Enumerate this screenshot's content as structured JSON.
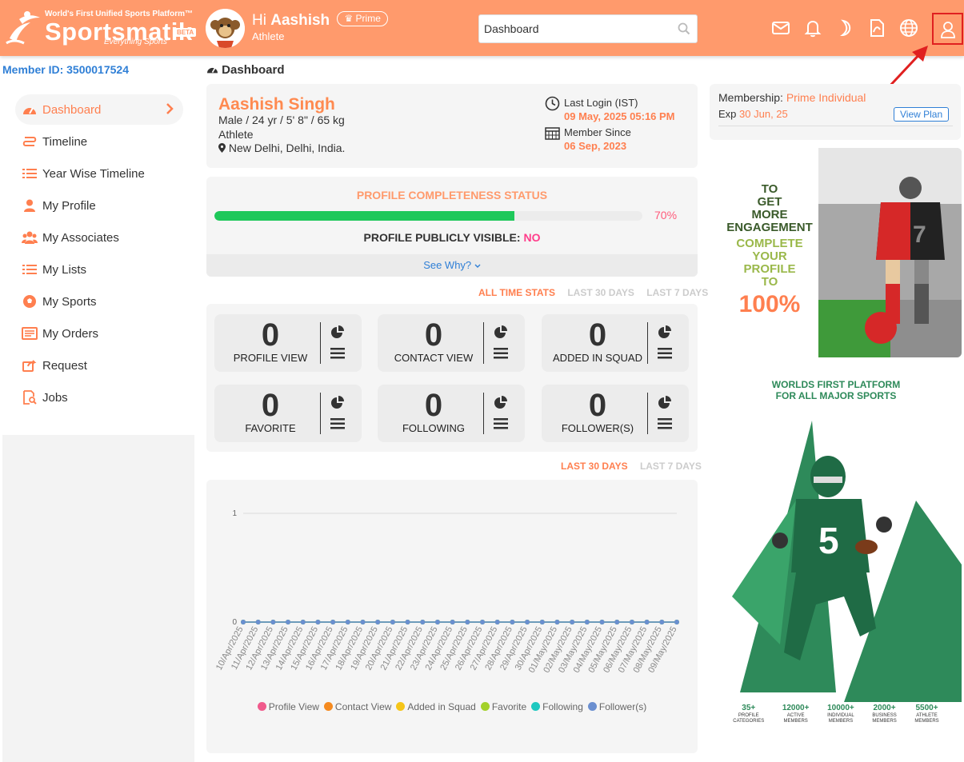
{
  "header": {
    "tagline": "World's First Unified Sports Platform™",
    "brand": "Sportsmatik",
    "beta": "BETA",
    "subtag": "Everything Sports",
    "greeting_prefix": "Hi",
    "user_first_name": "Aashish",
    "prime_badge": "Prime",
    "role": "Athlete",
    "search_value": "Dashboard",
    "bg_color": "#ff9a6c"
  },
  "member_id": "Member ID: 3500017524",
  "breadcrumb": "Dashboard",
  "sidebar": {
    "items": [
      {
        "label": "Dashboard",
        "icon": "dashboard-gauge-icon",
        "active": true
      },
      {
        "label": "Timeline",
        "icon": "timeline-route-icon"
      },
      {
        "label": "Year Wise Timeline",
        "icon": "list-icon"
      },
      {
        "label": "My Profile",
        "icon": "user-icon"
      },
      {
        "label": "My Associates",
        "icon": "users-icon"
      },
      {
        "label": "My Lists",
        "icon": "list-icon"
      },
      {
        "label": "My Sports",
        "icon": "soccer-ball-icon"
      },
      {
        "label": "My Orders",
        "icon": "orders-icon"
      },
      {
        "label": "Request",
        "icon": "share-request-icon"
      },
      {
        "label": "Jobs",
        "icon": "jobs-search-icon"
      }
    ]
  },
  "profile": {
    "name": "Aashish Singh",
    "details": "Male / 24 yr / 5' 8\" / 65 kg",
    "role": "Athlete",
    "location": "New Delhi, Delhi, India.",
    "last_login_label": "Last Login (IST)",
    "last_login_value": "09 May, 2025 05:16 PM",
    "member_since_label": "Member Since",
    "member_since_value": "06 Sep, 2023"
  },
  "completeness": {
    "title": "PROFILE COMPLETENESS STATUS",
    "percent": 70,
    "percent_label": "70%",
    "visible_label": "PROFILE PUBLICLY VISIBLE:",
    "visible_value": "NO",
    "see_why": "See Why?"
  },
  "stat_tabs": [
    "ALL TIME STATS",
    "LAST 30 DAYS",
    "LAST 7 DAYS"
  ],
  "stats": [
    {
      "value": "0",
      "label": "PROFILE VIEW"
    },
    {
      "value": "0",
      "label": "CONTACT VIEW"
    },
    {
      "value": "0",
      "label": "ADDED IN SQUAD"
    },
    {
      "value": "0",
      "label": "FAVORITE"
    },
    {
      "value": "0",
      "label": "FOLLOWING"
    },
    {
      "value": "0",
      "label": "FOLLOWER(S)"
    }
  ],
  "chart_tabs": [
    "LAST 30 DAYS",
    "LAST 7 DAYS"
  ],
  "chart_data": {
    "type": "line",
    "x": [
      "10/Apr/2025",
      "11/Apr/2025",
      "12/Apr/2025",
      "13/Apr/2025",
      "14/Apr/2025",
      "15/Apr/2025",
      "16/Apr/2025",
      "17/Apr/2025",
      "18/Apr/2025",
      "19/Apr/2025",
      "20/Apr/2025",
      "21/Apr/2025",
      "22/Apr/2025",
      "23/Apr/2025",
      "24/Apr/2025",
      "25/Apr/2025",
      "26/Apr/2025",
      "27/Apr/2025",
      "28/Apr/2025",
      "29/Apr/2025",
      "30/Apr/2025",
      "01/May/2025",
      "02/May/2025",
      "03/May/2025",
      "04/May/2025",
      "05/May/2025",
      "06/May/2025",
      "07/May/2025",
      "08/May/2025",
      "09/May/2025"
    ],
    "yticks": [
      0,
      1
    ],
    "ylim": [
      0,
      1
    ],
    "series": [
      {
        "name": "Profile View",
        "color": "#f05a8c",
        "values": [
          0,
          0,
          0,
          0,
          0,
          0,
          0,
          0,
          0,
          0,
          0,
          0,
          0,
          0,
          0,
          0,
          0,
          0,
          0,
          0,
          0,
          0,
          0,
          0,
          0,
          0,
          0,
          0,
          0,
          0
        ]
      },
      {
        "name": "Contact View",
        "color": "#f58a1f",
        "values": [
          0,
          0,
          0,
          0,
          0,
          0,
          0,
          0,
          0,
          0,
          0,
          0,
          0,
          0,
          0,
          0,
          0,
          0,
          0,
          0,
          0,
          0,
          0,
          0,
          0,
          0,
          0,
          0,
          0,
          0
        ]
      },
      {
        "name": "Added in Squad",
        "color": "#f5c518",
        "values": [
          0,
          0,
          0,
          0,
          0,
          0,
          0,
          0,
          0,
          0,
          0,
          0,
          0,
          0,
          0,
          0,
          0,
          0,
          0,
          0,
          0,
          0,
          0,
          0,
          0,
          0,
          0,
          0,
          0,
          0
        ]
      },
      {
        "name": "Favorite",
        "color": "#a3d12a",
        "values": [
          0,
          0,
          0,
          0,
          0,
          0,
          0,
          0,
          0,
          0,
          0,
          0,
          0,
          0,
          0,
          0,
          0,
          0,
          0,
          0,
          0,
          0,
          0,
          0,
          0,
          0,
          0,
          0,
          0,
          0
        ]
      },
      {
        "name": "Following",
        "color": "#1ec8c0",
        "values": [
          0,
          0,
          0,
          0,
          0,
          0,
          0,
          0,
          0,
          0,
          0,
          0,
          0,
          0,
          0,
          0,
          0,
          0,
          0,
          0,
          0,
          0,
          0,
          0,
          0,
          0,
          0,
          0,
          0,
          0
        ]
      },
      {
        "name": "Follower(s)",
        "color": "#6b8fd0",
        "values": [
          0,
          0,
          0,
          0,
          0,
          0,
          0,
          0,
          0,
          0,
          0,
          0,
          0,
          0,
          0,
          0,
          0,
          0,
          0,
          0,
          0,
          0,
          0,
          0,
          0,
          0,
          0,
          0,
          0,
          0
        ]
      }
    ],
    "grid": true,
    "legend": "bottom"
  },
  "membership": {
    "label": "Membership:",
    "plan": "Prime Individual",
    "exp_label": "Exp",
    "exp_date": "30 Jun, 25",
    "view_plan": "View Plan"
  },
  "ad1": {
    "line1": "TO",
    "line2": "GET",
    "line3": "MORE",
    "line4": "ENGAGEMENT",
    "line5": "COMPLETE",
    "line6": "YOUR",
    "line7": "PROFILE",
    "line8": "TO",
    "line9": "100%"
  },
  "ad2": {
    "head1": "WORLDS FIRST PLATFORM",
    "head2": "FOR ALL MAJOR SPORTS",
    "stats": [
      {
        "value": "35+",
        "l1": "PROFILE",
        "l2": "CATEGORIES"
      },
      {
        "value": "12000+",
        "l1": "ACTIVE",
        "l2": "MEMBERS"
      },
      {
        "value": "10000+",
        "l1": "INDIVIDUAL",
        "l2": "MEMBERS"
      },
      {
        "value": "2000+",
        "l1": "BUSINESS",
        "l2": "MEMBERS"
      },
      {
        "value": "5500+",
        "l1": "ATHLETE",
        "l2": "MEMBERS"
      }
    ]
  },
  "colors": {
    "accent": "#ff7f4f",
    "link": "#2f7fd6",
    "progress": "#1ec85a",
    "highlight_box": "#e02020"
  }
}
